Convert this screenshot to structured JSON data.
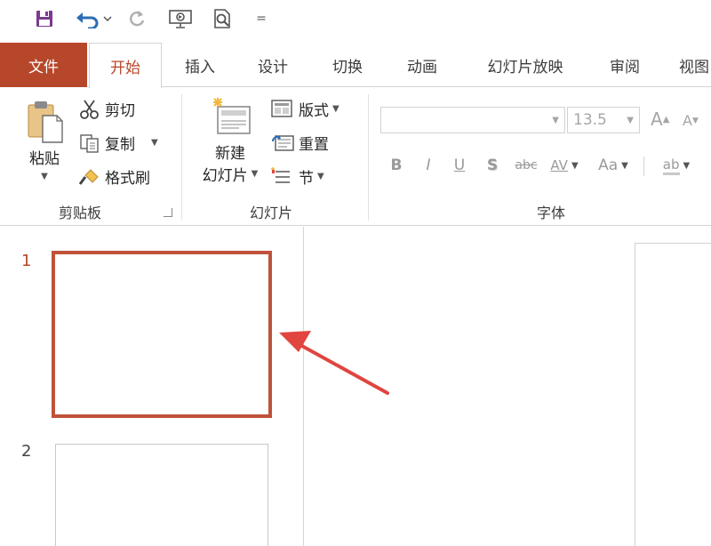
{
  "quick_access": {
    "save_icon": "save-icon",
    "undo_icon": "undo-icon",
    "redo_icon": "redo-icon",
    "presenter_icon": "presenter-view-icon",
    "preview_icon": "print-preview-icon",
    "customize_glyph": "="
  },
  "tabs": [
    {
      "label": "文件"
    },
    {
      "label": "开始"
    },
    {
      "label": "插入"
    },
    {
      "label": "设计"
    },
    {
      "label": "切换"
    },
    {
      "label": "动画"
    },
    {
      "label": "幻灯片放映"
    },
    {
      "label": "审阅"
    },
    {
      "label": "视图"
    }
  ],
  "clipboard": {
    "paste_label": "粘贴",
    "cut_label": "剪切",
    "copy_label": "复制",
    "format_painter_label": "格式刷",
    "group_label": "剪贴板"
  },
  "slides_group": {
    "new_slide_line1": "新建",
    "new_slide_line2": "幻灯片",
    "layout_label": "版式",
    "reset_label": "重置",
    "section_label": "节",
    "group_label": "幻灯片"
  },
  "font": {
    "font_name_value": "",
    "font_size_value": "13.5",
    "grow_label": "A",
    "shrink_label": "A",
    "bold_label": "B",
    "italic_label": "I",
    "underline_label": "U",
    "shadow_label": "S",
    "strike_label": "abc",
    "spacing_label": "AV",
    "case_label": "Aa",
    "clear_label": "ab",
    "group_label": "字体"
  },
  "thumbnails": [
    {
      "number": "1",
      "selected": true
    },
    {
      "number": "2",
      "selected": false
    }
  ],
  "colors": {
    "accent": "#b7472a",
    "selection_border": "#c0523a",
    "annotation_arrow": "#e0453f"
  }
}
